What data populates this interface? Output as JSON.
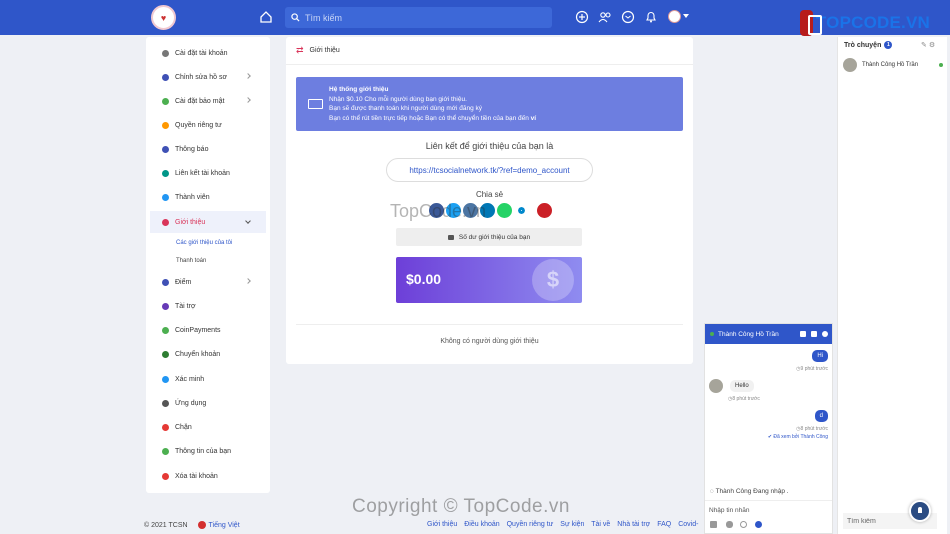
{
  "header": {
    "search_placeholder": "Tìm kiếm",
    "brand_watermark": "TOPCODE.VN"
  },
  "sidebar": {
    "items": [
      {
        "label": "Cài đặt tài khoản",
        "color": "#777777"
      },
      {
        "label": "Chỉnh sửa hồ sơ",
        "color": "#3f51b5"
      },
      {
        "label": "Cài đặt bảo mật",
        "color": "#4caf50"
      },
      {
        "label": "Quyền riêng tư",
        "color": "#ff9800"
      },
      {
        "label": "Thông báo",
        "color": "#3f51b5"
      },
      {
        "label": "Liên kết tài khoản",
        "color": "#009688"
      },
      {
        "label": "Thành viên",
        "color": "#2196f3"
      },
      {
        "label": "Giới thiệu",
        "color": "#d9355a"
      },
      {
        "label": "Điểm",
        "color": "#3f51b5"
      },
      {
        "label": "Tài trợ",
        "color": "#673ab7"
      },
      {
        "label": "CoinPayments",
        "color": "#4caf50"
      },
      {
        "label": "Chuyển khoản",
        "color": "#2e7d32"
      },
      {
        "label": "Xác minh",
        "color": "#2196f3"
      },
      {
        "label": "Ứng dụng",
        "color": "#555555"
      },
      {
        "label": "Chặn",
        "color": "#e53935"
      },
      {
        "label": "Thông tin của bạn",
        "color": "#4caf50"
      },
      {
        "label": "Xóa tài khoản",
        "color": "#e53935"
      }
    ],
    "sub_items": [
      "Các giới thiệu của tôi",
      "Thanh toán"
    ]
  },
  "main": {
    "title": "Giới thiệu",
    "info": {
      "title": "Hệ thống giới thiệu",
      "line1": "Nhận $0.10 Cho mỗi người dùng bạn giới thiệu.",
      "line2": "Bạn sẽ được thanh toán khi người dùng mới đăng ký",
      "line3": "Bạn có thể rút tiền trực tiếp hoặc Bạn có thể chuyển tiền của bạn đến",
      "wallet": "ví"
    },
    "ref_title": "Liên kết để giới thiệu của bạn là",
    "ref_link": "https://tcsocialnetwork.tk/?ref=demo_account",
    "share_title": "Chia sẻ",
    "share_colors": [
      "#3b5998",
      "#1da1f2",
      "#4c75a3",
      "#0077b5",
      "#25d366",
      "#ffffff",
      "#0088cc",
      "#ffffff",
      "#cb2027"
    ],
    "balance_button": "Số dư giới thiệu của bạn",
    "balance_amount": "$0.00",
    "no_referrals": "Không có người dùng giới thiệu"
  },
  "right_sidebar": {
    "title": "Trò chuyện",
    "badge": "1",
    "contact_name": "Thành Công Hồ Trần",
    "search_placeholder": "Tìm kiếm"
  },
  "chat": {
    "name": "Thành Công Hồ Trần",
    "msg1": "Hi",
    "ts1": "◷9 phút trước",
    "msg2": "Hello",
    "ts2": "◷8 phút trước",
    "msg3": "d",
    "ts3": "◷8 phút trước",
    "seen": "✔ Đã xem bởi Thành Công",
    "typing": "Thành Công Đang nhập .",
    "input_placeholder": "Nhập tin nhắn"
  },
  "footer": {
    "copyright": "© 2021 TCSN",
    "language": "Tiếng Việt",
    "links": [
      "Giới thiệu",
      "Điều khoản",
      "Quyền riêng tư",
      "Sự kiện",
      "Tài về",
      "Nhà tài trợ",
      "FAQ",
      "Covid-"
    ]
  },
  "watermarks": {
    "center": "TopCode.vn",
    "bottom": "Copyright © TopCode.vn"
  }
}
